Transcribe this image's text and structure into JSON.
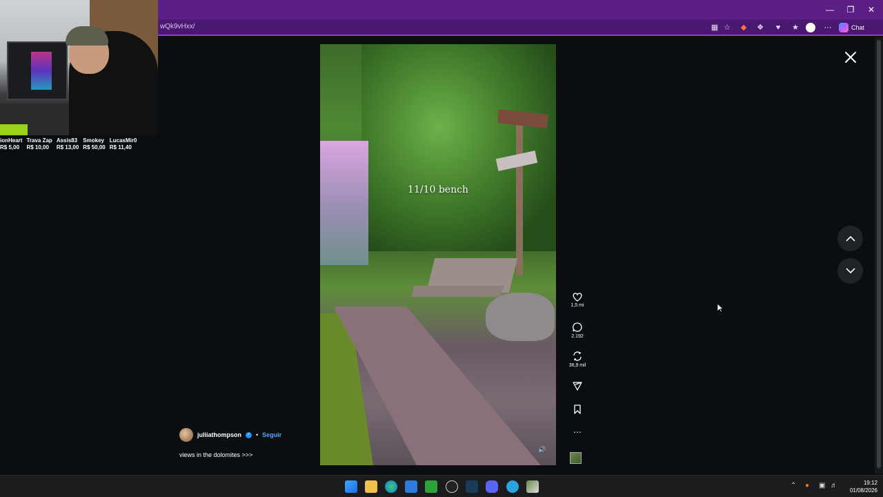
{
  "browser": {
    "url_fragment": "wQk9vHxx/",
    "chat_label": "Chat",
    "window_controls": [
      "minimize",
      "restore",
      "close"
    ]
  },
  "stream_overlay": {
    "donations": [
      {
        "name": "ionHeart",
        "amount": "R$ 5,00"
      },
      {
        "name": "Trava Zap",
        "amount": "R$ 10,00"
      },
      {
        "name": "Assis83",
        "amount": "R$ 13,00"
      },
      {
        "name": "Smokey",
        "amount": "R$ 50,00"
      },
      {
        "name": "LucasMir0",
        "amount": "R$ 11,40"
      }
    ]
  },
  "post": {
    "caption_overlay": "11/10 bench",
    "author": "juliiathompson",
    "verified": true,
    "separator": "•",
    "follow_label": "Seguir",
    "description": "views in the dolomites >>>",
    "likes": "1,5 mi",
    "comments": "2.192",
    "reposts": "36,9 mil"
  },
  "taskbar": {
    "time": "19:12",
    "date": "01/08/2026"
  },
  "colors": {
    "browser_frame": "#5b1f86",
    "accent": "#8b3fd1",
    "follow_link": "#5aa6ff",
    "page_background": "#0b0e11"
  }
}
